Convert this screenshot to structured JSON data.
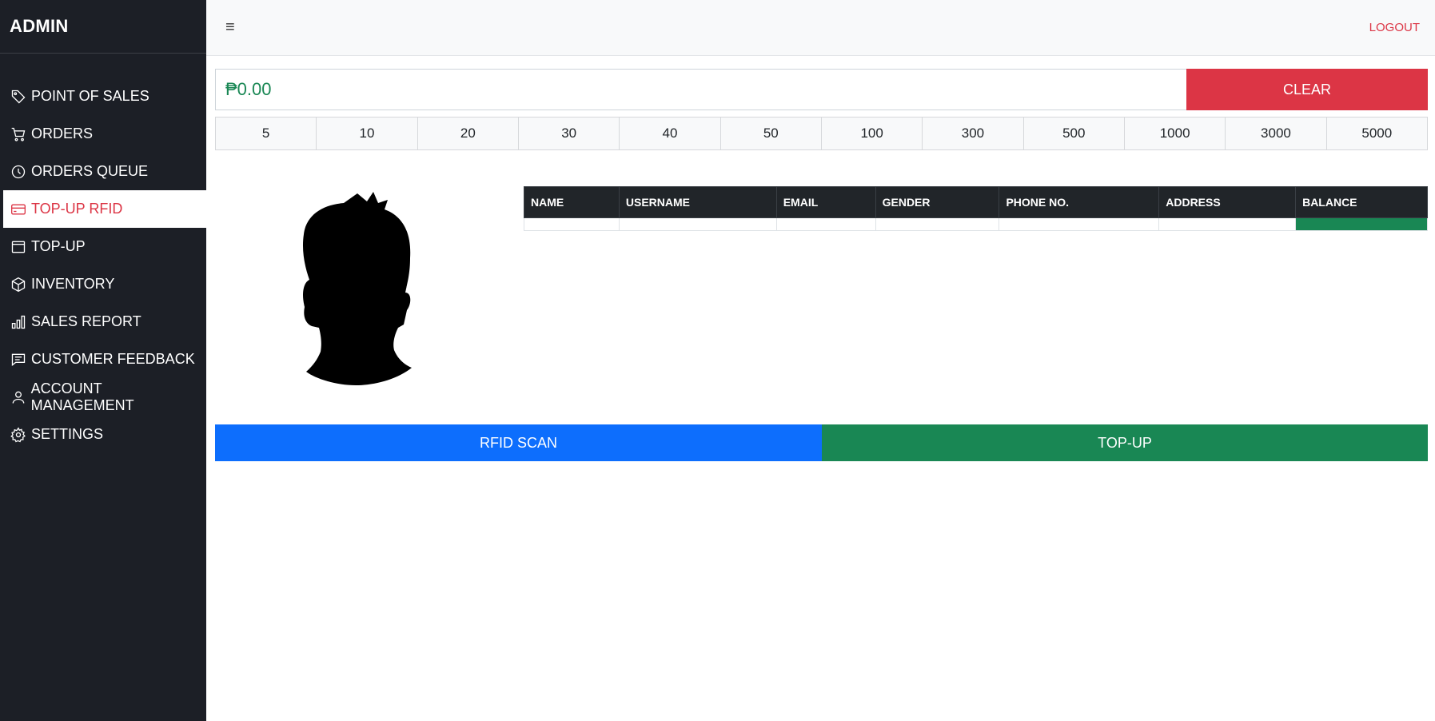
{
  "sidebar": {
    "brand": "ADMIN",
    "items": [
      {
        "label": "POINT OF SALES",
        "icon": "tag-icon"
      },
      {
        "label": "ORDERS",
        "icon": "cart-icon"
      },
      {
        "label": "ORDERS QUEUE",
        "icon": "clock-icon"
      },
      {
        "label": "TOP-UP RFID",
        "icon": "credit-card-icon",
        "active": true
      },
      {
        "label": "TOP-UP",
        "icon": "window-icon"
      },
      {
        "label": "INVENTORY",
        "icon": "box-icon"
      },
      {
        "label": "SALES REPORT",
        "icon": "bar-chart-icon"
      },
      {
        "label": "CUSTOMER FEEDBACK",
        "icon": "chat-icon"
      },
      {
        "label": "ACCOUNT MANAGEMENT",
        "icon": "person-icon"
      },
      {
        "label": "SETTINGS",
        "icon": "gear-icon"
      }
    ]
  },
  "topbar": {
    "menu_icon": "≡",
    "logout_label": "LOGOUT"
  },
  "amount": {
    "value": "₱0.00",
    "clear_label": "CLEAR"
  },
  "denominations": [
    "5",
    "10",
    "20",
    "30",
    "40",
    "50",
    "100",
    "300",
    "500",
    "1000",
    "3000",
    "5000"
  ],
  "table": {
    "headers": [
      "NAME",
      "USERNAME",
      "EMAIL",
      "GENDER",
      "PHONE NO.",
      "ADDRESS",
      "BALANCE"
    ],
    "rows": [
      [
        "",
        "",
        "",
        "",
        "",
        "",
        ""
      ]
    ]
  },
  "actions": {
    "scan_label": "RFID SCAN",
    "topup_label": "TOP-UP"
  },
  "colors": {
    "sidebar_bg": "#1c1f26",
    "active_text": "#dc3545",
    "clear_btn": "#dc3545",
    "scan_btn": "#0d6efd",
    "topup_btn": "#198754",
    "amount_text": "#198754"
  }
}
